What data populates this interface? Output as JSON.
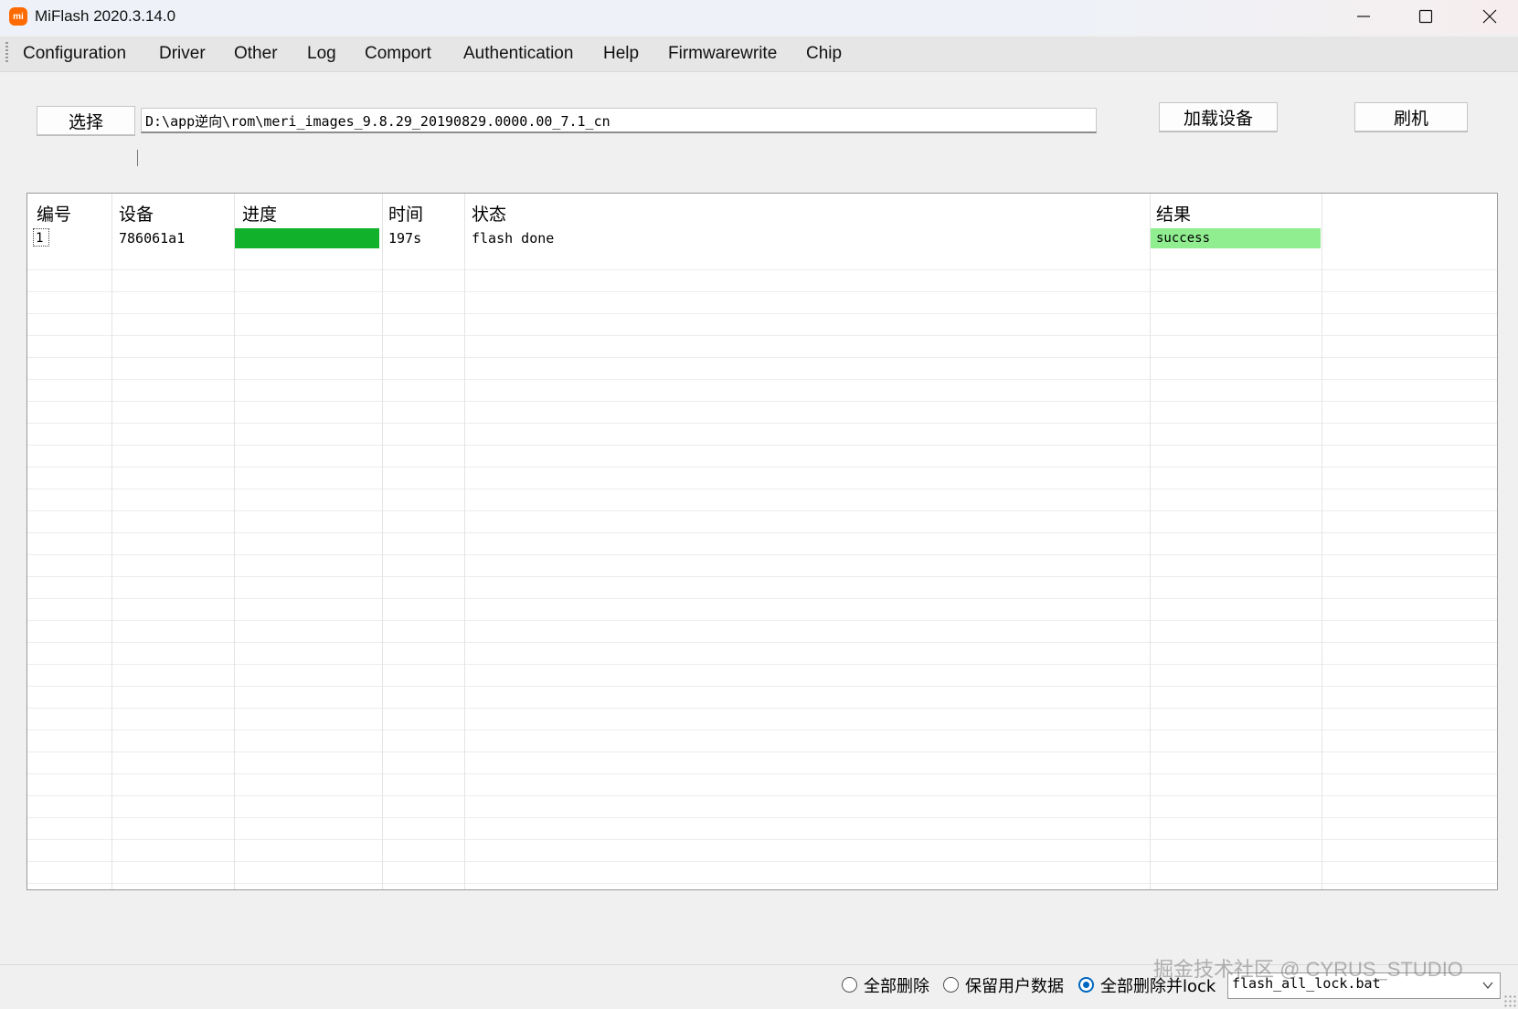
{
  "window": {
    "logo_text": "mi",
    "title": "MiFlash 2020.3.14.0"
  },
  "menu": [
    "Configuration",
    "Driver",
    "Other",
    "Log",
    "Comport",
    "Authentication",
    "Help",
    "Firmwarewrite",
    "Chip"
  ],
  "toolbar": {
    "select_label": "选择",
    "path_value": "D:\\app逆向\\rom\\meri_images_9.8.29_20190829.0000.00_7.1_cn",
    "load_devices_label": "加载设备",
    "flash_label": "刷机"
  },
  "grid": {
    "columns": [
      "编号",
      "设备",
      "进度",
      "时间",
      "状态",
      "结果"
    ],
    "rows": [
      {
        "id": "1",
        "device": "786061a1",
        "progress": 1.0,
        "time": "197s",
        "status": "flash done",
        "result": "success"
      }
    ],
    "colors": {
      "progress": "#12b12c",
      "success": "#90ee90"
    }
  },
  "footer": {
    "options": [
      {
        "label": "全部删除",
        "checked": false
      },
      {
        "label": "保留用户数据",
        "checked": false
      },
      {
        "label": "全部删除并lock",
        "checked": true
      }
    ],
    "script_value": "flash_all_lock.bat",
    "watermark": "掘金技术社区 @ CYRUS_STUDIO"
  }
}
